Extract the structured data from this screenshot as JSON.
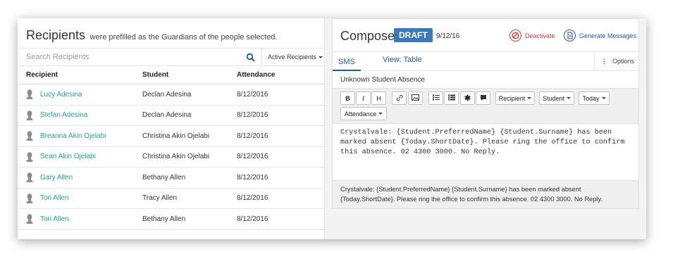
{
  "recipients": {
    "title": "Recipients",
    "subtitle": "were prefilled as the Guardians of the people selected.",
    "search_placeholder": "Search Recipients",
    "filter_label": "Active Recipients",
    "columns": [
      "Recipient",
      "Student",
      "Attendance"
    ],
    "rows": [
      {
        "recipient": "Lucy Adesina",
        "student": "Declan Adesina",
        "attendance": "8/12/2016"
      },
      {
        "recipient": "Stefan Adesina",
        "student": "Declan Adesina",
        "attendance": "8/12/2016"
      },
      {
        "recipient": "Breanna Akin Ojelabi",
        "student": "Christina Akin Ojelabi",
        "attendance": "8/12/2016"
      },
      {
        "recipient": "Sean Akin Ojelabi",
        "student": "Christina Akin Ojelabi",
        "attendance": "8/12/2016"
      },
      {
        "recipient": "Gary Allen",
        "student": "Bethany Allen",
        "attendance": "8/12/2016"
      },
      {
        "recipient": "Tori Allen",
        "student": "Tracy Allen",
        "attendance": "8/12/2016"
      },
      {
        "recipient": "Tori Allen",
        "student": "Bethany Allen",
        "attendance": "8/12/2016"
      }
    ]
  },
  "compose": {
    "title": "Compose",
    "status_badge": "DRAFT",
    "date": "9/12/16",
    "deactivate_label": "Deactivate",
    "generate_label": "Generate Messages",
    "tab_sms": "SMS",
    "view_label": "View: Table",
    "options_label": "Options",
    "subject": "Unknown Student Absence",
    "toolbar": {
      "bold": "B",
      "italic": "I",
      "heading": "H",
      "recipient": "Recipient",
      "student": "Student",
      "today": "Today",
      "attendance": "Attendance"
    },
    "editor_lines": [
      "Crystalvale: {Student.PreferredName} {Student.Surname} has been",
      "marked absent {Today.ShortDate}. Please ring the office to confirm",
      "this absence. 02 4300 3000. No Reply."
    ],
    "preview_lines": [
      "Crystalvale: {Student.PreferredName} {Student.Surname} has been marked absent",
      "{Today.ShortDate}. Please ring the office to confirm this absence. 02 4300 3000. No Reply."
    ]
  },
  "colors": {
    "accent": "#3b79b8",
    "link": "#2a9d8a",
    "danger": "#c9413a",
    "primary_text": "#2b57a8"
  }
}
